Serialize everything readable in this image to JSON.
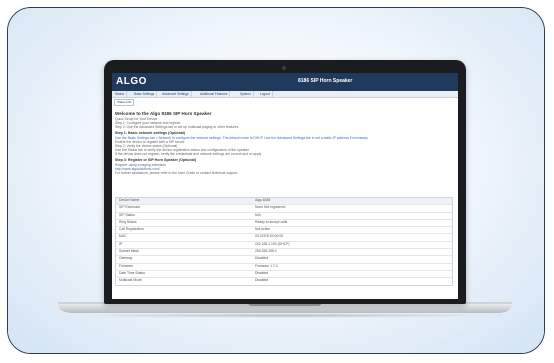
{
  "app": {
    "logo": "ALGO",
    "page_title": "8186 SIP Horn Speaker"
  },
  "nav": [
    {
      "label": "Status"
    },
    {
      "label": "Basic Settings"
    },
    {
      "label": "Advanced Settings"
    },
    {
      "label": "Additional Features"
    },
    {
      "label": "System"
    },
    {
      "label": "Logout"
    }
  ],
  "subnav": {
    "label": "Status Info"
  },
  "content": {
    "welcome": "Welcome to the Algo 8186 SIP Horn Speaker",
    "intro_lines": [
      "Quick Setup for Your Device",
      "Step 1: Configure your network and register",
      "Step 2: Use the Advanced Settings tab to set up multicast paging or other features"
    ],
    "step1_heading": "Step 1: Basic network settings (Optional)",
    "step1_lines": [
      "Use the Basic Settings tab > Network to configure the network settings. The default mode is DHCP. Use the Advanced Settings tab to set a static IP address if necessary",
      "Enable the device to register with a SIP server",
      "Step 2: Verify the device status (Optional)"
    ],
    "step2_lines": [
      "Use the Status tab to verify the device registration status and configuration of the speaker",
      "If the device does not register, verify the credentials and network settings are correct and re-apply"
    ],
    "step3_heading": "Step 3: Register or SIP Horn Speaker (Optional)",
    "step3_lines": [
      "Register using a paging extension",
      "http://www.algosolutions.com/",
      "For further assistance, please refer to the User Guide or contact technical support"
    ]
  },
  "status_table": {
    "header": {
      "label": "Device Name",
      "value": "Algo 8186"
    },
    "rows": [
      {
        "label": "SIP Extension",
        "value": "None    Not registered"
      },
      {
        "label": "SIP Status",
        "value": "N/A"
      },
      {
        "label": "Ring Status",
        "value": "Ready to accept calls"
      },
      {
        "label": "Call Registration",
        "value": "Not active"
      },
      {
        "label": "MAC",
        "value": "00:22:EE:03:00:00"
      },
      {
        "label": "IP",
        "value": "192.168.1.100 (DHCP)"
      },
      {
        "label": "Subnet Mask",
        "value": "255.255.255.0"
      },
      {
        "label": "Gateway",
        "value": "Disabled"
      },
      {
        "label": "Firmware",
        "value": "Firmware 1.7.0"
      },
      {
        "label": "Date Time Status",
        "value": "Disabled"
      },
      {
        "label": "Multicast Mode",
        "value": "Disabled"
      }
    ]
  }
}
